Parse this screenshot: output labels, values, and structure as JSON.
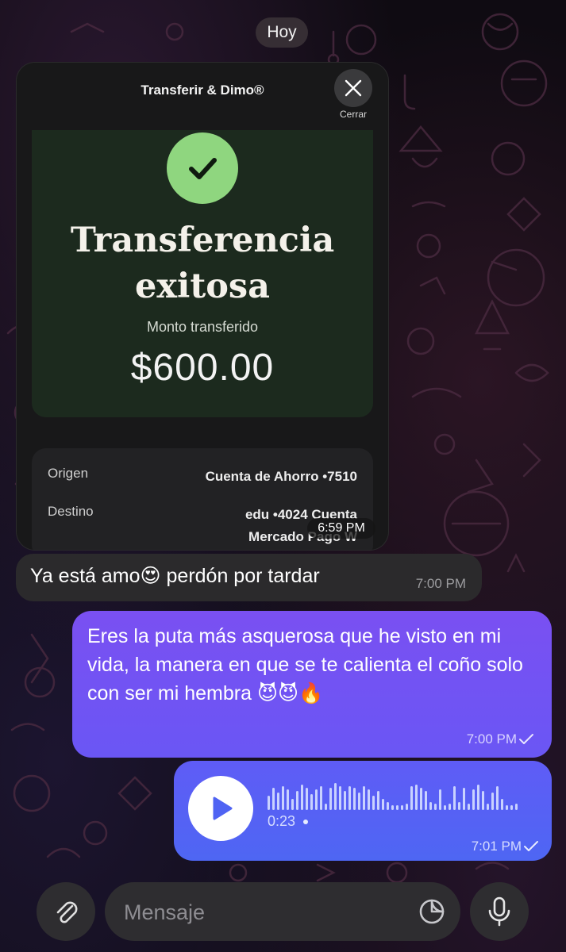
{
  "date_separator": "Hoy",
  "image_message": {
    "card_title": "Transferir & Dimo®",
    "close_label": "Cerrar",
    "status_line1": "Transferencia",
    "status_line2": "exitosa",
    "amount_label": "Monto transferido",
    "amount": "$600.00",
    "origin_label": "Origen",
    "origin_value": "Cuenta de Ahorro •7510",
    "destination_label": "Destino",
    "destination_value_line1": "edu •4024 Cuenta",
    "destination_value_line2": "Mercado Pago W",
    "time": "6:59 PM"
  },
  "incoming_text": {
    "text": "Ya está amo😍 perdón por tardar",
    "time": "7:00 PM"
  },
  "outgoing_text": {
    "text": "Eres la puta más asquerosa que he visto en mi vida, la manera en que se te calienta el coño solo con ser mi hembra 😈😈🔥",
    "time": "7:00 PM"
  },
  "voice_message": {
    "duration": "0:23",
    "time": "7:01 PM"
  },
  "input_bar": {
    "placeholder": "Mensaje"
  },
  "colors": {
    "outgoing_bubble": "#7550f2",
    "voice_bubble": "#5562f4",
    "incoming_bubble": "#2b2a2c",
    "success_check": "#8fd67f"
  }
}
